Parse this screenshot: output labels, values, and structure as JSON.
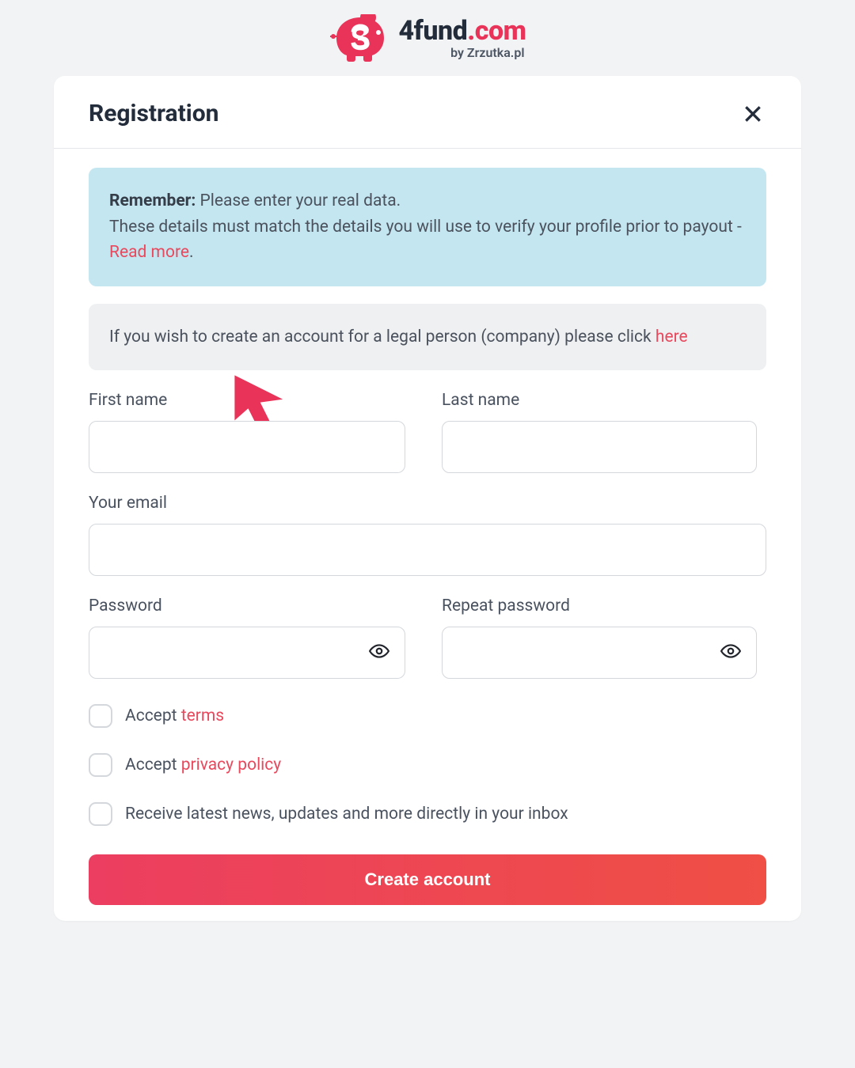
{
  "logo": {
    "brand_main": "4fund",
    "brand_suffix": ".com",
    "subtext": "by Zrzutka.pl"
  },
  "modal": {
    "title": "Registration",
    "alert_remember_label": "Remember:",
    "alert_remember_text1": " Please enter your real data.",
    "alert_remember_text2": "These details must match the details you will use to verify your profile prior to payout - ",
    "alert_remember_link": "Read more",
    "alert_remember_text3": ".",
    "alert_company_text1": "If you wish to create an account for a legal person (company) please click ",
    "alert_company_link": "here",
    "labels": {
      "first_name": "First name",
      "last_name": "Last name",
      "email": "Your email",
      "password": "Password",
      "repeat_password": "Repeat password"
    },
    "checkboxes": {
      "accept": "Accept ",
      "terms_link": "terms",
      "privacy_link": "privacy policy",
      "newsletter": "Receive latest news, updates and more directly in your inbox"
    },
    "submit_label": "Create account"
  }
}
